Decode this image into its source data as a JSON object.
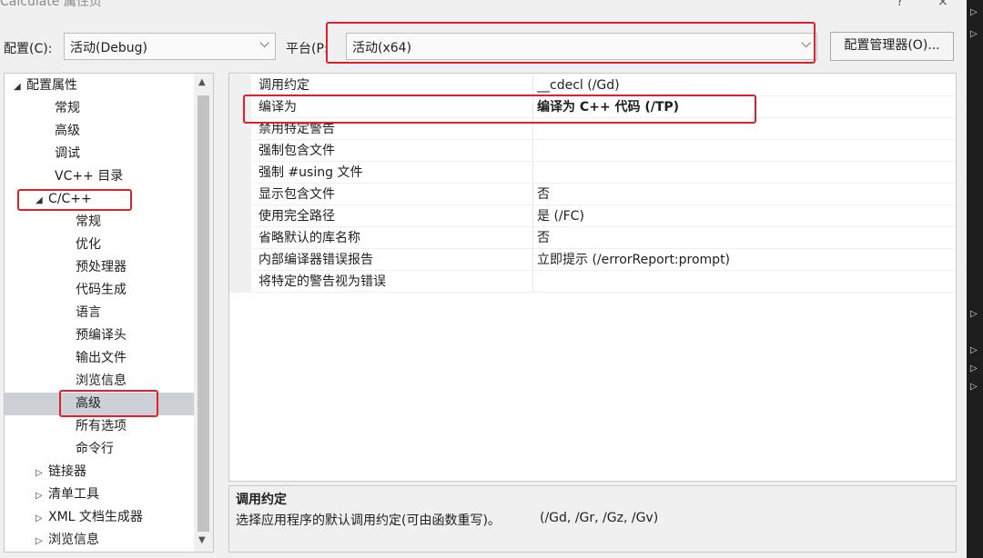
{
  "window": {
    "title": "Calculate 属性页",
    "help_button": "?",
    "close_button": "×"
  },
  "toolbar": {
    "config_label": "配置(C):",
    "config_value": "活动(Debug)",
    "platform_label": "平台(P:",
    "platform_value": "活动(x64)",
    "config_manager_button": "配置管理器(O)..."
  },
  "tree": {
    "root": "配置属性",
    "root_children": [
      "常规",
      "高级",
      "调试",
      "VC++ 目录"
    ],
    "cpp": "C/C++",
    "cpp_children": [
      "常规",
      "优化",
      "预处理器",
      "代码生成",
      "语言",
      "预编译头",
      "输出文件",
      "浏览信息",
      "高级",
      "所有选项",
      "命令行"
    ],
    "selected_index": 8,
    "other_nodes": [
      "链接器",
      "清单工具",
      "XML 文档生成器",
      "浏览信息"
    ]
  },
  "properties": [
    {
      "name": "调用约定",
      "value": "__cdecl (/Gd)",
      "bold": false
    },
    {
      "name": "编译为",
      "value": "编译为 C++ 代码 (/TP)",
      "bold": true
    },
    {
      "name": "禁用特定警告",
      "value": "",
      "bold": false
    },
    {
      "name": "强制包含文件",
      "value": "",
      "bold": false
    },
    {
      "name": "强制 #using 文件",
      "value": "",
      "bold": false
    },
    {
      "name": "显示包含文件",
      "value": "否",
      "bold": false
    },
    {
      "name": "使用完全路径",
      "value": "是 (/FC)",
      "bold": false
    },
    {
      "name": "省略默认的库名称",
      "value": "否",
      "bold": false
    },
    {
      "name": "内部编译器错误报告",
      "value": "立即提示 (/errorReport:prompt)",
      "bold": false
    },
    {
      "name": "将特定的警告视为错误",
      "value": "",
      "bold": false
    }
  ],
  "description": {
    "title": "调用约定",
    "text": "选择应用程序的默认调用约定(可由函数重写)。",
    "values": "(/Gd, /Gr, /Gz, /Gv)"
  },
  "colors": {
    "highlight_border": "#e0212b",
    "selection": "#cdd0d6"
  }
}
